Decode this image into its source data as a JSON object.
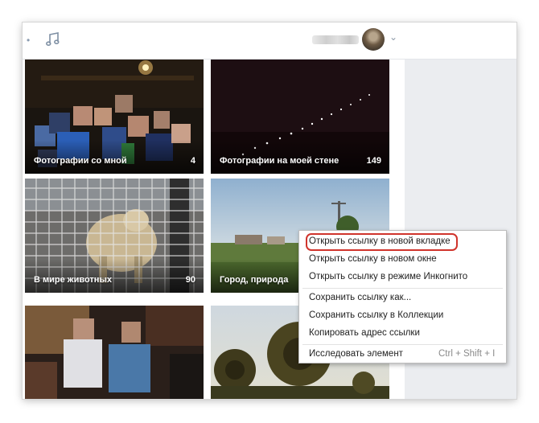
{
  "header": {
    "music_icon": "music-note-icon",
    "chevron_icon": "chevron-down-icon"
  },
  "albums": [
    {
      "title": "Фотографии со мной",
      "count": "4"
    },
    {
      "title": "Фотографии на моей стене",
      "count": "149"
    },
    {
      "title": "В мире животных",
      "count": "90"
    },
    {
      "title": "Город, природа",
      "count": ""
    },
    {
      "title": "",
      "count": ""
    },
    {
      "title": "",
      "count": ""
    }
  ],
  "context_menu": {
    "items": [
      {
        "label": "Открыть ссылку в новой вкладке",
        "shortcut": ""
      },
      {
        "label": "Открыть ссылку в новом окне",
        "shortcut": ""
      },
      {
        "label": "Открыть ссылку в режиме Инкогнито",
        "shortcut": ""
      },
      {
        "label": "Сохранить ссылку как...",
        "shortcut": ""
      },
      {
        "label": "Сохранить ссылку в Коллекции",
        "shortcut": ""
      },
      {
        "label": "Копировать адрес ссылки",
        "shortcut": ""
      },
      {
        "label": "Исследовать элемент",
        "shortcut": "Ctrl + Shift + I"
      }
    ],
    "highlighted_item": "Открыть ссылку в новой вкладке",
    "highlight_color": "#d0342c"
  },
  "colors": {
    "sidebar": "#ebedf0",
    "topbar_border": "#e4e6ea"
  }
}
